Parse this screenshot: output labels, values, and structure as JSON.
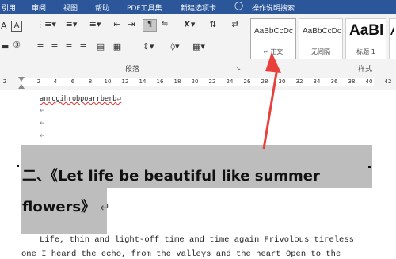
{
  "menu": {
    "items": [
      "引用",
      "审阅",
      "视图",
      "帮助",
      "PDF工具集",
      "新建选项卡",
      "操作说明搜索"
    ]
  },
  "ribbon": {
    "font_group_label": "段落",
    "styles_group_label": "样式",
    "style_cards": [
      {
        "sample": "AaBbCcDc",
        "name": "正文",
        "selected": true
      },
      {
        "sample": "AaBbCcDc",
        "name": "无间隔",
        "selected": false
      },
      {
        "sample": "AaBl",
        "name": "标题 1",
        "selected": false
      },
      {
        "sample": "A",
        "name": "",
        "selected": false
      }
    ],
    "left_icons": [
      "A",
      "A"
    ]
  },
  "ruler": {
    "ticks": [
      "2",
      "2",
      "4",
      "6",
      "8",
      "10",
      "12",
      "14",
      "16",
      "18",
      "20",
      "22",
      "24",
      "26",
      "28",
      "30",
      "32",
      "34",
      "36",
      "38",
      "40",
      "42"
    ]
  },
  "document": {
    "line1": "anrogihrobpoarrberb",
    "paragraph_mark": "↵",
    "heading_line1": "二、《Let life be beautiful like summer",
    "heading_line2": "flowers》",
    "body_line1": "Life, thin and light-off time and time again Frivolous tireless",
    "body_line2": "one I heard the echo, from the valleys and the heart Open to the"
  },
  "colors": {
    "menubar": "#2b579a",
    "ribbon": "#f3f3f3",
    "highlight": "#bdbdbd",
    "arrow": "#e8403a"
  }
}
